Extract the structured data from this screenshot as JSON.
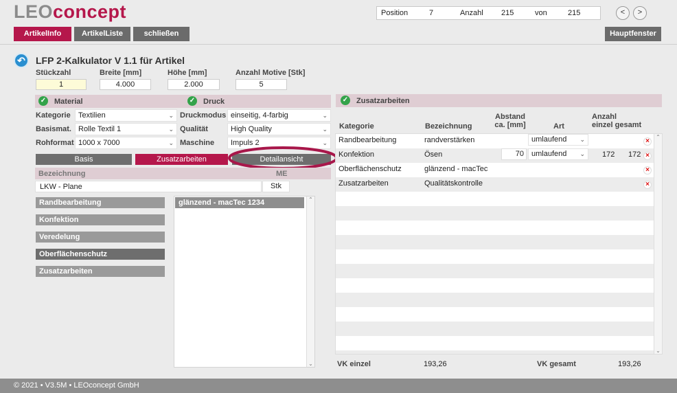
{
  "header": {
    "logo_part1": "LEO",
    "logo_part2": "concept",
    "nav": {
      "position_label": "Position",
      "position_value": "7",
      "anzahl_label": "Anzahl",
      "anzahl_value": "215",
      "von_label": "von",
      "von_value": "215",
      "prev_label": "<",
      "next_label": ">"
    },
    "buttons": {
      "artikelinfo": "ArtikelInfo",
      "artikelliste": "ArtikelListe",
      "schliessen": "schließen",
      "hauptfenster": "Hauptfenster"
    }
  },
  "main": {
    "title": "LFP 2-Kalkulator V 1.1 für Artikel",
    "fields": {
      "stueckzahl_label": "Stückzahl",
      "stueckzahl_value": "1",
      "breite_label": "Breite [mm]",
      "breite_value": "4.000",
      "hoehe_label": "Höhe [mm]",
      "hoehe_value": "2.000",
      "motive_label": "Anzahl Motive [Stk]",
      "motive_value": "5"
    },
    "material": {
      "header": "Material",
      "kategorie_label": "Kategorie",
      "kategorie_value": "Textilien",
      "basismat_label": "Basismat.",
      "basismat_value": "Rolle Textil 1",
      "rohformat_label": "Rohformat",
      "rohformat_value": "1000 x 7000"
    },
    "druck": {
      "header": "Druck",
      "druckmodus_label": "Druckmodus",
      "druckmodus_value": "einseitig, 4-farbig",
      "qualitaet_label": "Qualität",
      "qualitaet_value": "High Quality",
      "maschine_label": "Maschine",
      "maschine_value": "Impuls 2"
    },
    "tabs": {
      "basis": "Basis",
      "zusatzarbeiten": "Zusatzarbeiten",
      "detailansicht": "Detailansicht"
    },
    "bezeichnung": {
      "header": "Bezeichnung",
      "me_header": "ME",
      "row_value": "LKW - Plane",
      "row_me": "Stk"
    },
    "categories": [
      "Randbearbeitung",
      "Konfektion",
      "Veredelung",
      "Oberflächenschutz",
      "Zusatzarbeiten"
    ],
    "selected_item": "glänzend - macTec 1234"
  },
  "zusatz": {
    "header": "Zusatzarbeiten",
    "col_kategorie": "Kategorie",
    "col_bezeichnung": "Bezeichnung",
    "col_abstand_1": "Abstand",
    "col_abstand_2": "ca. [mm]",
    "col_art": "Art",
    "col_anzahl_1": "Anzahl",
    "col_anzahl_2": "einzel gesamt",
    "rows": [
      {
        "kategorie": "Randbearbeitung",
        "bezeichnung": "randverstärken",
        "abstand": "",
        "art": "umlaufend",
        "einzel": "",
        "gesamt": ""
      },
      {
        "kategorie": "Konfektion",
        "bezeichnung": "Ösen",
        "abstand": "70",
        "art": "umlaufend",
        "einzel": "172",
        "gesamt": "172"
      },
      {
        "kategorie": "Oberflächenschutz",
        "bezeichnung": "glänzend - macTec",
        "abstand": "",
        "art": "",
        "einzel": "",
        "gesamt": ""
      },
      {
        "kategorie": "Zusatzarbeiten",
        "bezeichnung": "Qualitätskontrolle",
        "abstand": "",
        "art": "",
        "einzel": "",
        "gesamt": ""
      }
    ],
    "vk_einzel_label": "VK einzel",
    "vk_einzel_value": "193,26",
    "vk_gesamt_label": "VK gesamt",
    "vk_gesamt_value": "193,26"
  },
  "footer": {
    "text": "© 2021 • V3.5M • LEOconcept GmbH"
  },
  "colors": {
    "accent": "#b5174b",
    "header_tint": "#dfcdd3",
    "highlight_ring": "#a8174a"
  }
}
